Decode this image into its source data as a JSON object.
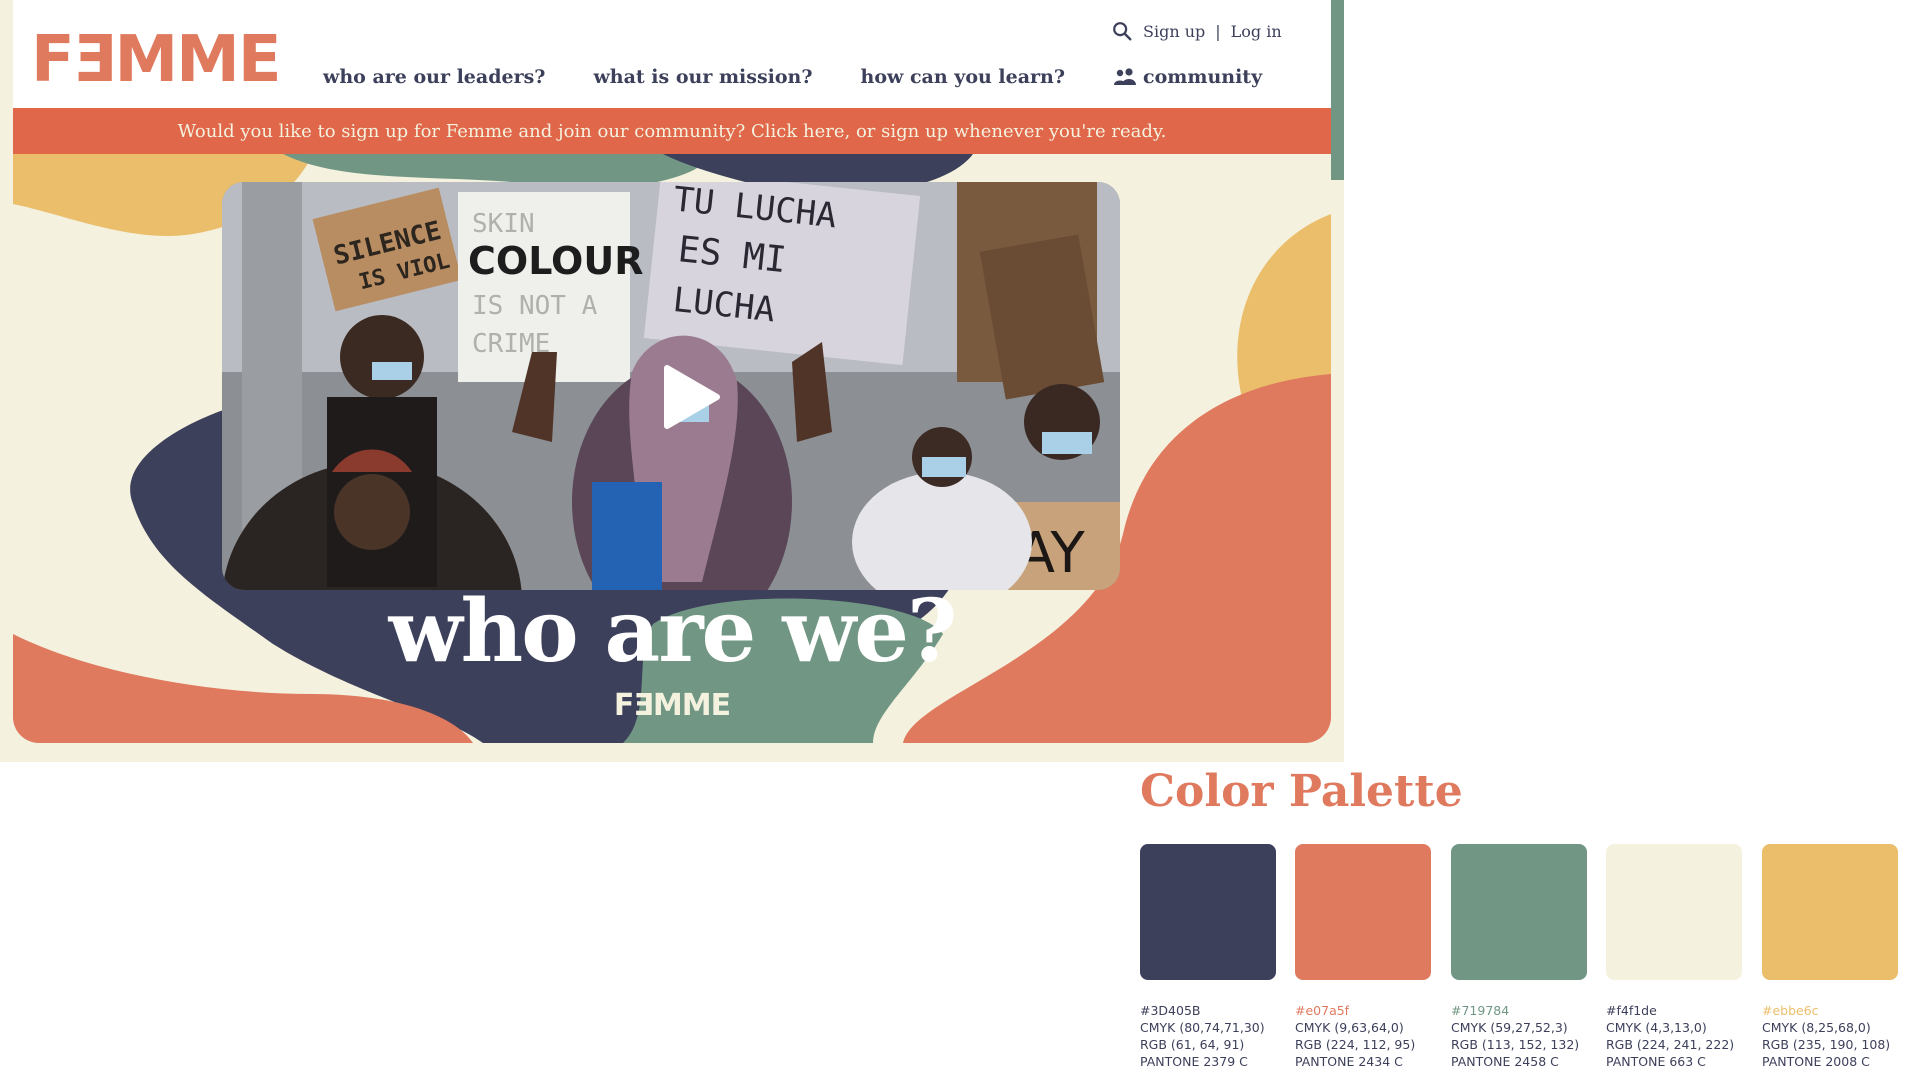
{
  "site": {
    "logo": "FƎMME",
    "top_links": {
      "signup": "Sign up",
      "divider": "|",
      "login": "Log in"
    },
    "nav": [
      {
        "label": "who are our leaders?"
      },
      {
        "label": "what is our mission?"
      },
      {
        "label": "how can you learn?"
      },
      {
        "label": "community",
        "icon": "people-icon"
      }
    ],
    "banner": "Would you like to sign up for Femme and join our community? Click here, or sign up whenever you're ready.",
    "video": {
      "signs": [
        "SILENCE IS VIOLENCE",
        "SKIN COLOUR IS NOT A CRIME",
        "TU LUCHA ES MI LUCHA",
        "SAY"
      ]
    },
    "headline": "who are we?",
    "mini_logo": "FƎMME"
  },
  "palette": {
    "title": "Color Palette",
    "colors": [
      {
        "hex": "#3D405B",
        "cmyk": "CMYK (80,74,71,30)",
        "rgb": "RGB (61, 64, 91)",
        "pantone": "PANTONE 2379 C",
        "swatch": "#3d405b",
        "hex_color": "#3d405b"
      },
      {
        "hex": "#e07a5f",
        "cmyk": "CMYK (9,63,64,0)",
        "rgb": "RGB (224, 112, 95)",
        "pantone": "PANTONE 2434 C",
        "swatch": "#e07a5f",
        "hex_color": "#e07a5f"
      },
      {
        "hex": "#719784",
        "cmyk": "CMYK (59,27,52,3)",
        "rgb": "RGB (113, 152, 132)",
        "pantone": "PANTONE 2458 C",
        "swatch": "#719784",
        "hex_color": "#719784"
      },
      {
        "hex": "#f4f1de",
        "cmyk": "CMYK (4,3,13,0)",
        "rgb": "RGB (224, 241, 222)",
        "pantone": "PANTONE 663 C",
        "swatch": "#f4f1de",
        "hex_color": "#3d405b"
      },
      {
        "hex": "#ebbe6c",
        "cmyk": "CMYK (8,25,68,0)",
        "rgb": "RGB (235, 190, 108)",
        "pantone": "PANTONE 2008 C",
        "swatch": "#ebbe6c",
        "hex_color": "#ebbe6c"
      }
    ]
  },
  "colors": {
    "navy": "#3d405b",
    "coral": "#e07a5f",
    "green": "#719784",
    "cream": "#f4f1de",
    "gold": "#ebbe6c",
    "banner": "#e0674a"
  }
}
